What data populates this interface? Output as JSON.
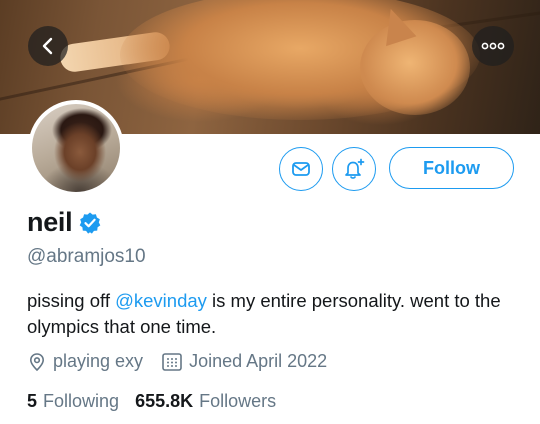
{
  "header": {
    "banner_icon": "cat-photo",
    "back_icon": "chevron-left-icon",
    "more_icon": "more-dots-icon"
  },
  "profile": {
    "avatar_icon": "avatar-photo",
    "display_name": "neil",
    "verified": true,
    "handle": "@abramjos10",
    "bio_before": "pissing off ",
    "bio_mention": "@kevinday",
    "bio_after": " is my entire personality. went to the olympics that one time.",
    "location": "playing exy",
    "joined": "Joined April 2022"
  },
  "actions": {
    "message_icon": "envelope-icon",
    "notify_icon": "bell-plus-icon",
    "follow_label": "Follow"
  },
  "stats": {
    "following_count": "5",
    "following_label": "Following",
    "followers_count": "655.8K",
    "followers_label": "Followers"
  },
  "colors": {
    "accent": "#1d9bf0",
    "secondary_text": "#657786",
    "primary_text": "#14171a"
  }
}
